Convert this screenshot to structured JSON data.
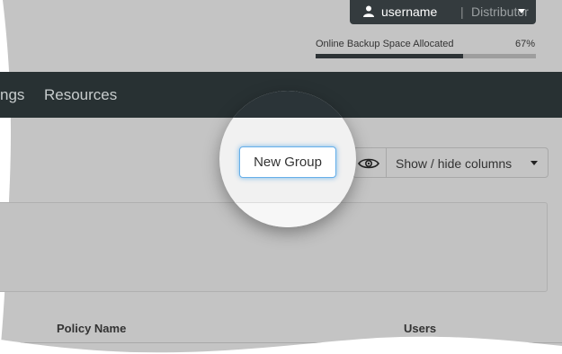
{
  "user_menu": {
    "username": "username",
    "separator": "|",
    "role": "Distributor"
  },
  "quota": {
    "label": "Online Backup Space Allocated",
    "value_text": "67%",
    "fraction": 0.67
  },
  "nav": {
    "items": [
      {
        "label": "ngs"
      },
      {
        "label": "Resources"
      }
    ]
  },
  "toolbar": {
    "new_group_label": "New Group",
    "columns_label": "Show / hide columns"
  },
  "table": {
    "headers": [
      "Policy Name",
      "Users"
    ]
  },
  "colors": {
    "navbar": "#283133",
    "user_button": "#343b3e",
    "focus_ring": "#66afe9"
  }
}
